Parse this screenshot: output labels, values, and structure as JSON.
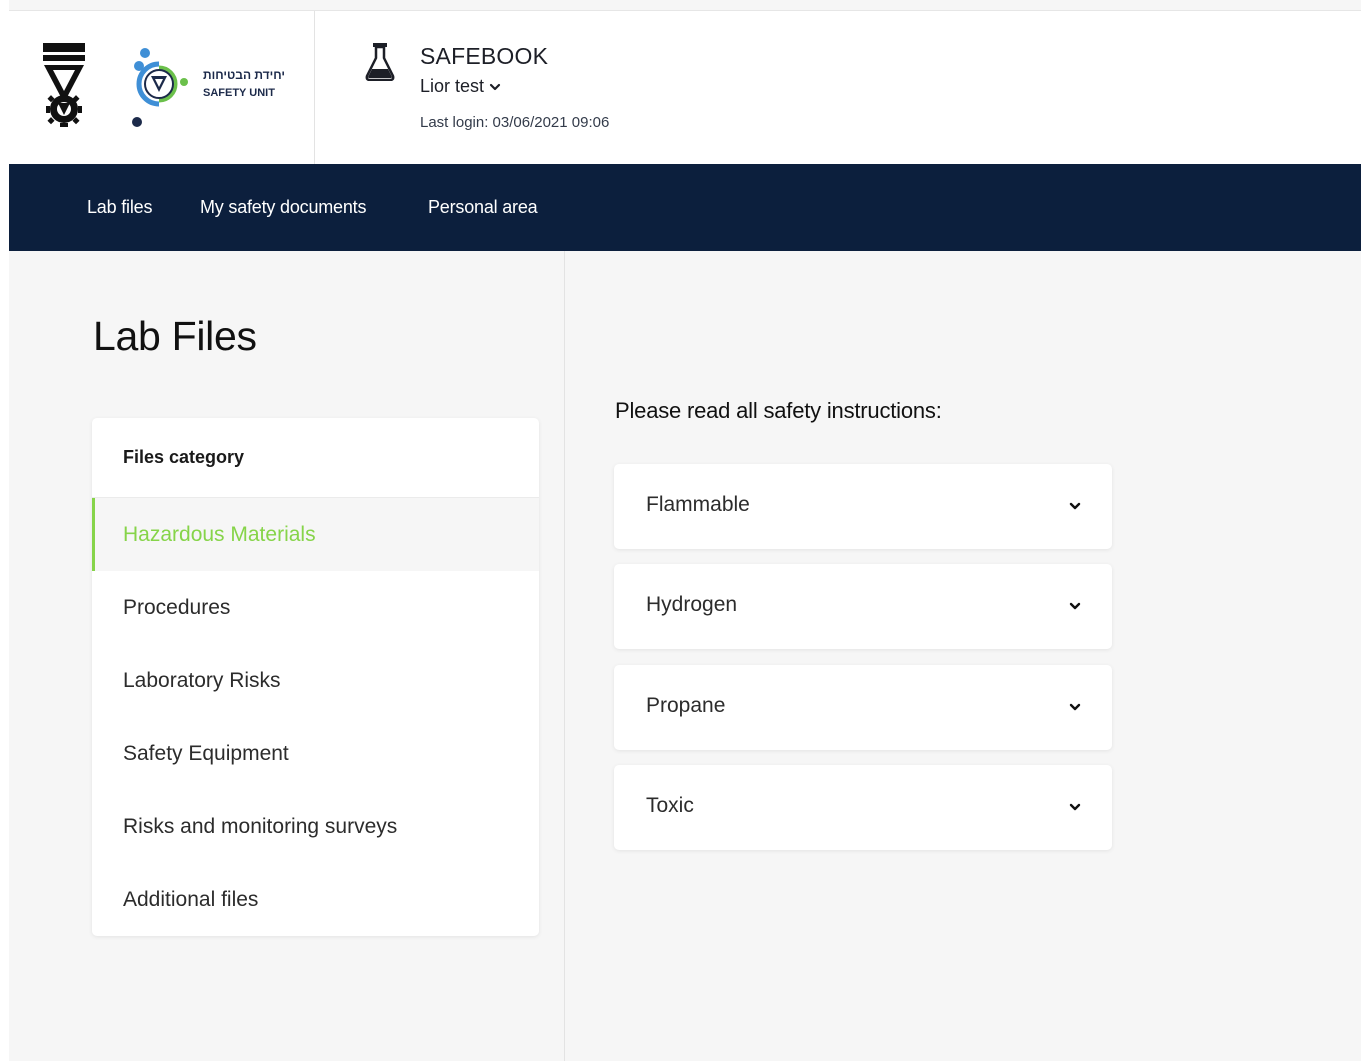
{
  "header": {
    "logo_he_text": "יחידת הבטיחות",
    "logo_en_text": "SAFETY UNIT",
    "app_title": "SAFEBOOK",
    "user_name": "Lior test",
    "last_login": "Last login: 03/06/2021 09:06",
    "icons": [
      "technion-logo",
      "safety-unit-logo",
      "flask-icon",
      "chevron-down-icon"
    ]
  },
  "nav": {
    "items": [
      {
        "label": "Lab files"
      },
      {
        "label": "My safety documents"
      },
      {
        "label": "Personal area"
      }
    ]
  },
  "main": {
    "title": "Lab Files",
    "category_header": "Files category",
    "categories": [
      {
        "label": "Hazardous Materials",
        "active": true
      },
      {
        "label": "Procedures",
        "active": false
      },
      {
        "label": "Laboratory Risks",
        "active": false
      },
      {
        "label": "Safety Equipment",
        "active": false
      },
      {
        "label": "Risks and monitoring surveys",
        "active": false
      },
      {
        "label": "Additional files",
        "active": false
      }
    ],
    "instructions_title": "Please read all safety instructions:",
    "accordions": [
      {
        "label": "Flammable"
      },
      {
        "label": "Hydrogen"
      },
      {
        "label": "Propane"
      },
      {
        "label": "Toxic"
      }
    ]
  },
  "colors": {
    "nav_bg": "#0c1f3d",
    "accent_green": "#86d449",
    "page_bg": "#f6f6f6"
  }
}
